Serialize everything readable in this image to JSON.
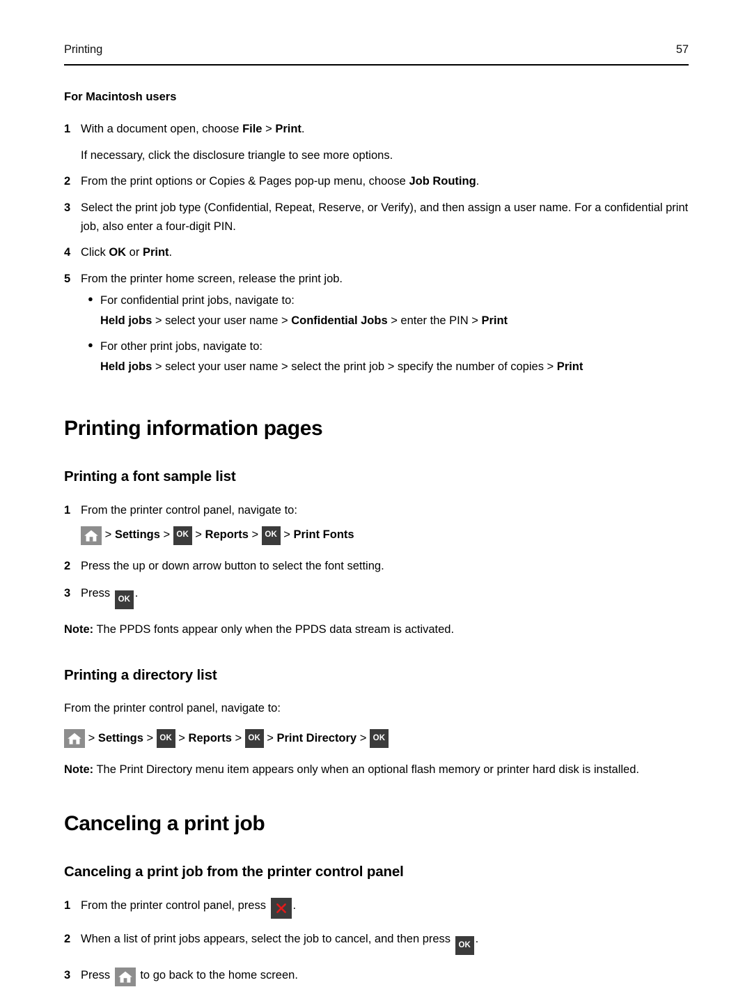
{
  "header": {
    "title": "Printing",
    "page_number": "57"
  },
  "macintosh": {
    "heading": "For Macintosh users",
    "steps": [
      {
        "number": "1",
        "parts": [
          {
            "text": "With a document open, choose ",
            "bold": false
          },
          {
            "text": "File",
            "bold": true
          },
          {
            "text": " > ",
            "bold": false
          },
          {
            "text": "Print",
            "bold": true
          },
          {
            "text": ".",
            "bold": false
          }
        ],
        "continuation": "If necessary, click the disclosure triangle to see more options."
      },
      {
        "number": "2",
        "parts": [
          {
            "text": "From the print options or Copies & Pages pop-up menu, choose ",
            "bold": false
          },
          {
            "text": "Job Routing",
            "bold": true
          },
          {
            "text": ".",
            "bold": false
          }
        ]
      },
      {
        "number": "3",
        "parts": [
          {
            "text": "Select the print job type (Confidential, Repeat, Reserve, or Verify), and then assign a user name. For a confidential print job, also enter a four-digit PIN.",
            "bold": false
          }
        ]
      },
      {
        "number": "4",
        "parts": [
          {
            "text": "Click ",
            "bold": false
          },
          {
            "text": "OK",
            "bold": true
          },
          {
            "text": " or ",
            "bold": false
          },
          {
            "text": "Print",
            "bold": true
          },
          {
            "text": ".",
            "bold": false
          }
        ]
      },
      {
        "number": "5",
        "parts": [
          {
            "text": "From the printer home screen, release the print job.",
            "bold": false
          }
        ]
      }
    ],
    "bullets": [
      {
        "lead": "For confidential print jobs, navigate to:",
        "path_parts": [
          {
            "text": "Held jobs",
            "bold": true
          },
          {
            "text": " > select your user name > ",
            "bold": false
          },
          {
            "text": "Confidential Jobs",
            "bold": true
          },
          {
            "text": " > enter the PIN > ",
            "bold": false
          },
          {
            "text": "Print",
            "bold": true
          }
        ]
      },
      {
        "lead": "For other print jobs, navigate to:",
        "path_parts": [
          {
            "text": "Held jobs",
            "bold": true
          },
          {
            "text": " > select your user name > select the print job > specify the number of copies > ",
            "bold": false
          },
          {
            "text": "Print",
            "bold": true
          }
        ]
      }
    ]
  },
  "info_pages": {
    "title": "Printing information pages",
    "font_sample": {
      "title": "Printing a font sample list",
      "step1_number": "1",
      "step1_text": "From the printer control panel, navigate to:",
      "navpath": [
        {
          "type": "icon",
          "icon": "home-icon"
        },
        {
          "type": "sep",
          "text": " > "
        },
        {
          "type": "label",
          "text": "Settings"
        },
        {
          "type": "sep",
          "text": " > "
        },
        {
          "type": "icon",
          "icon": "ok-icon",
          "label": "OK"
        },
        {
          "type": "sep",
          "text": " > "
        },
        {
          "type": "label",
          "text": "Reports"
        },
        {
          "type": "sep",
          "text": " > "
        },
        {
          "type": "icon",
          "icon": "ok-icon",
          "label": "OK"
        },
        {
          "type": "sep",
          "text": " > "
        },
        {
          "type": "label",
          "text": "Print Fonts"
        }
      ],
      "step2_number": "2",
      "step2_text": "Press the up or down arrow button to select the font setting.",
      "step3_number": "3",
      "step3_prefix": "Press ",
      "step3_ok_label": "OK",
      "step3_suffix": ".",
      "note_label": "Note:",
      "note_text": " The PPDS fonts appear only when the PPDS data stream is activated."
    },
    "directory": {
      "title": "Printing a directory list",
      "intro": "From the printer control panel, navigate to:",
      "navpath": [
        {
          "type": "icon",
          "icon": "home-icon"
        },
        {
          "type": "sep",
          "text": " > "
        },
        {
          "type": "label",
          "text": "Settings"
        },
        {
          "type": "sep",
          "text": " > "
        },
        {
          "type": "icon",
          "icon": "ok-icon",
          "label": "OK"
        },
        {
          "type": "sep",
          "text": " > "
        },
        {
          "type": "label",
          "text": "Reports"
        },
        {
          "type": "sep",
          "text": " > "
        },
        {
          "type": "icon",
          "icon": "ok-icon",
          "label": "OK"
        },
        {
          "type": "sep",
          "text": " > "
        },
        {
          "type": "label",
          "text": "Print Directory"
        },
        {
          "type": "sep",
          "text": " > "
        },
        {
          "type": "icon",
          "icon": "ok-icon",
          "label": "OK"
        }
      ],
      "note_label": "Note:",
      "note_text": " The Print Directory menu item appears only when an optional flash memory or printer hard disk is installed."
    }
  },
  "canceling": {
    "title": "Canceling a print job",
    "control_panel": {
      "title": "Canceling a print job from the printer control panel",
      "step1_number": "1",
      "step1_prefix": "From the printer control panel, press ",
      "step1_suffix": ".",
      "step2_number": "2",
      "step2_prefix": "When a list of print jobs appears, select the job to cancel, and then press ",
      "step2_ok_label": "OK",
      "step2_suffix": ".",
      "step3_number": "3",
      "step3_prefix": "Press ",
      "step3_suffix": " to go back to the home screen."
    }
  },
  "icons": {
    "home": "home-icon",
    "ok": "ok-icon",
    "stop": "stop-x-icon"
  },
  "colors": {
    "home_chip_bg": "#8d8d8d",
    "ok_chip_bg": "#3b3b3b",
    "stop_chip_bg": "#3b3b3b",
    "stop_x": "#e01b1b",
    "text": "#000000",
    "page_bg": "#ffffff"
  }
}
